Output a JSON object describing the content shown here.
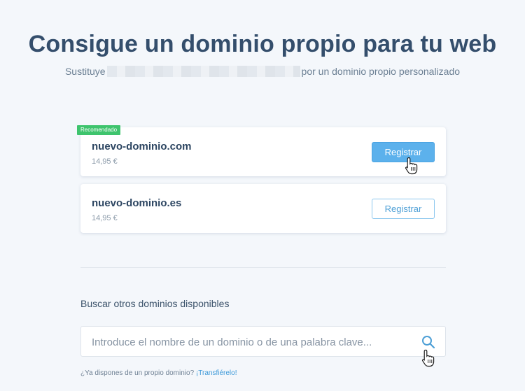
{
  "page": {
    "title": "Consigue un dominio propio para tu web",
    "subtitle_before": "Sustituye",
    "subtitle_after": "por un dominio propio personalizado"
  },
  "offers": [
    {
      "badge": "Recomendado",
      "domain": "nuevo-dominio.com",
      "price": "14,95 €",
      "button": "Registrar"
    },
    {
      "domain": "nuevo-dominio.es",
      "price": "14,95 €",
      "button": "Registrar"
    }
  ],
  "search": {
    "label": "Buscar otros dominios disponibles",
    "placeholder": "Introduce el nombre de un dominio o de una palabra clave..."
  },
  "transfer": {
    "question": "¿Ya dispones de un propio dominio?",
    "link": "¡Transfiérelo!"
  },
  "colors": {
    "accent": "#5cb1ec",
    "badge": "#3ec46d",
    "title": "#344e6c"
  },
  "icons": [
    "search-icon",
    "hand-pointer-icon"
  ]
}
